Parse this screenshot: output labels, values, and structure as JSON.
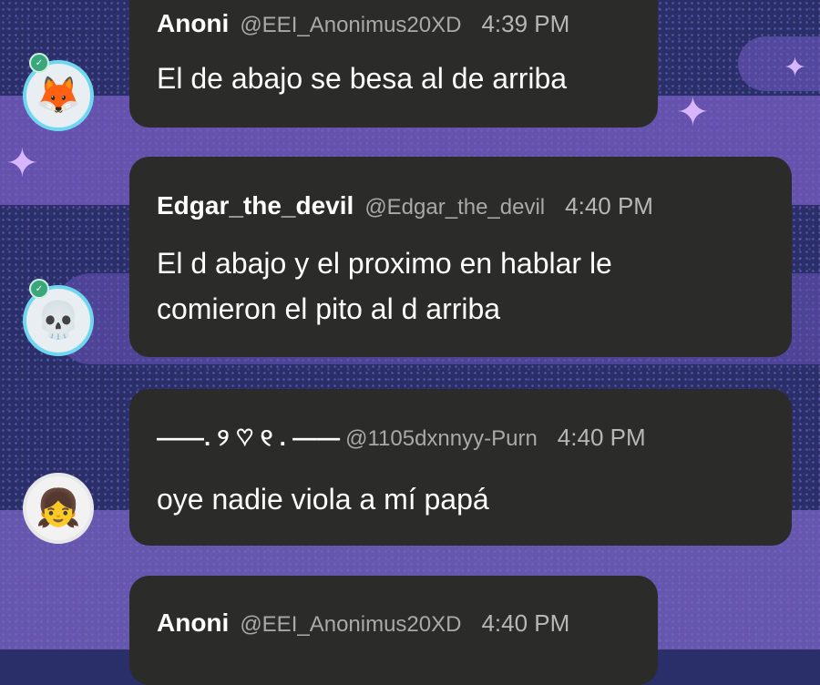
{
  "messages": [
    {
      "author": "Anoni",
      "handle": "@EEI_Anonimus20XD",
      "time": "4:39 PM",
      "lines": [
        "El de abajo se besa al de arriba"
      ],
      "avatar_icon": "fox-character-avatar-icon"
    },
    {
      "author": "Edgar_the_devil",
      "handle": "@Edgar_the_devil",
      "time": "4:40 PM",
      "lines": [
        "El d abajo y el proximo en hablar le",
        "comieron el pito al d arriba"
      ],
      "avatar_icon": "skull-mask-avatar-icon"
    },
    {
      "author": "——. ୨ ♡ ୧ .  ——",
      "handle": "@1105dxnnyy-Purn",
      "time": "4:40 PM",
      "lines": [
        "oye nadie viola a mí papá"
      ],
      "avatar_icon": "anime-girl-avatar-icon"
    },
    {
      "author": "Anoni",
      "handle": "@EEI_Anonimus20XD",
      "time": "4:40 PM",
      "lines": [],
      "avatar_icon": "fox-character-avatar-icon"
    }
  ],
  "colors": {
    "bubble": "#2b2b29",
    "avatar_ring": "#6fd7f0",
    "background": "#2a2f6a"
  }
}
